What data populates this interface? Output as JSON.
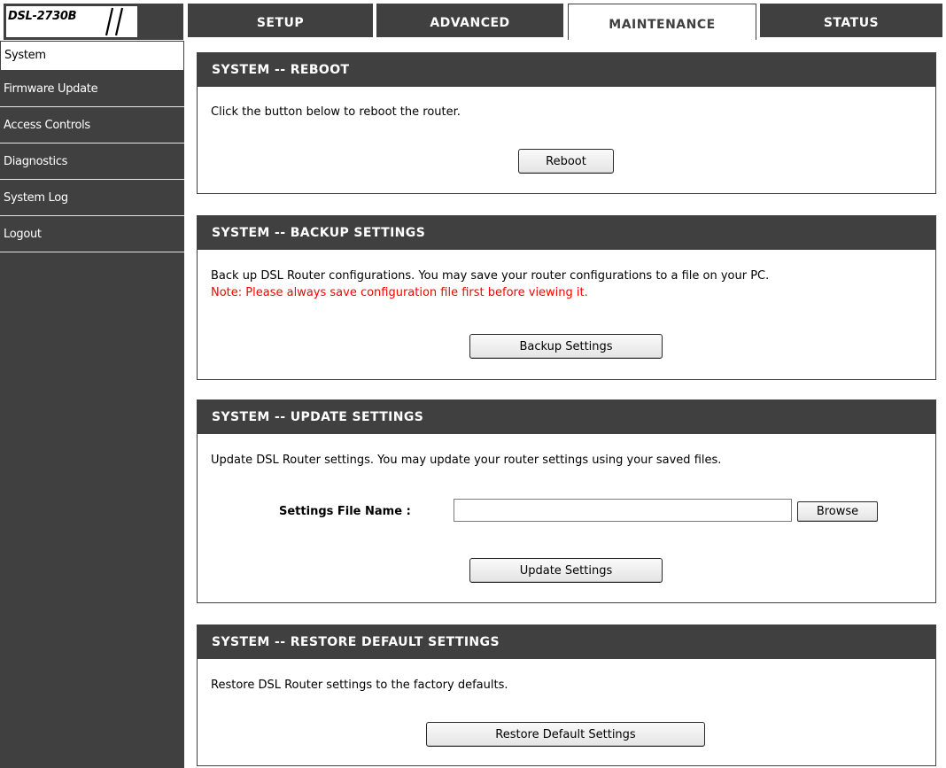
{
  "logo": {
    "text": "DSL-2730B"
  },
  "tabs": [
    {
      "label": "SETUP"
    },
    {
      "label": "ADVANCED"
    },
    {
      "label": "MAINTENANCE"
    },
    {
      "label": "STATUS"
    }
  ],
  "active_tab": "MAINTENANCE",
  "sidebar": {
    "items": [
      {
        "label": "System"
      },
      {
        "label": "Firmware Update"
      },
      {
        "label": "Access Controls"
      },
      {
        "label": "Diagnostics"
      },
      {
        "label": "System Log"
      },
      {
        "label": "Logout"
      }
    ],
    "active_item": "System"
  },
  "sections": {
    "reboot": {
      "title": "SYSTEM -- REBOOT",
      "text": "Click the button below to reboot the router.",
      "button": "Reboot"
    },
    "backup": {
      "title": "SYSTEM -- BACKUP SETTINGS",
      "text": "Back up DSL Router configurations. You may save your router configurations to a file on your PC.",
      "note": "Note: Please always save configuration file first before viewing it.",
      "button": "Backup Settings"
    },
    "update": {
      "title": "SYSTEM -- UPDATE SETTINGS",
      "text": "Update DSL Router settings. You may update your router settings using your saved files.",
      "file_label": "Settings File Name :",
      "file_value": "",
      "browse_button": "Browse",
      "button": "Update Settings"
    },
    "restore": {
      "title": "SYSTEM -- RESTORE DEFAULT SETTINGS",
      "text": "Restore DSL Router settings to the factory defaults.",
      "button": "Restore Default Settings"
    }
  },
  "colors": {
    "dark": "#404040",
    "note": "#ff0000",
    "background": "#ffffff"
  }
}
